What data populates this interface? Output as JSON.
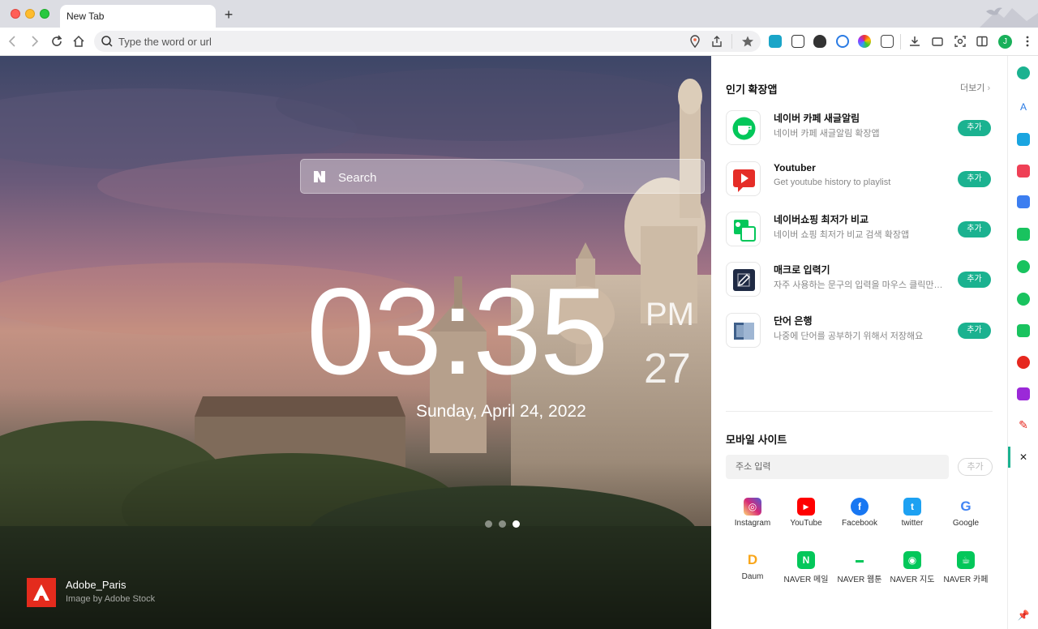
{
  "tab": {
    "title": "New Tab",
    "new_tab_symbol": "+"
  },
  "toolbar": {
    "url_placeholder": "Type the word or url",
    "profile_initial": "J",
    "icons": [
      "back-icon",
      "forward-icon",
      "reload-icon",
      "home-icon",
      "search-icon",
      "location-icon",
      "share-icon",
      "star-icon",
      "download-icon",
      "screen-capture-icon",
      "sidebar-toggle-icon",
      "more-menu-icon"
    ]
  },
  "newtab": {
    "search_placeholder": "Search",
    "clock": "03:35",
    "ampm": "PM",
    "seconds": "27",
    "date": "Sunday, April 24, 2022",
    "slides": 3,
    "active_slide": 3,
    "credit_title": "Adobe_Paris",
    "credit_subtitle": "Image by Adobe Stock"
  },
  "panel": {
    "popular_title": "인기 확장앱",
    "more_label": "더보기",
    "apps": [
      {
        "name": "네이버 카페 새글알림",
        "desc": "네이버 카페 새글알림 확장앱",
        "add": "추가",
        "icon": "cafe-icon",
        "color": "#03c75a"
      },
      {
        "name": "Youtuber",
        "desc": "Get youtube history to playlist",
        "add": "추가",
        "icon": "youtuber-icon",
        "color": "#e52d27"
      },
      {
        "name": "네이버쇼핑 최저가 비교",
        "desc": "네이버 쇼핑 최저가 비교 검색 확장앱",
        "add": "추가",
        "icon": "shopping-icon",
        "color": "#03c75a"
      },
      {
        "name": "매크로 입력기",
        "desc": "자주 사용하는 문구의 입력을 마우스 클릭만으로 입력할 수 있어요",
        "add": "추가",
        "icon": "macro-icon",
        "color": "#1f2a44"
      },
      {
        "name": "단어 은행",
        "desc": "나중에 단어를 공부하기 위해서 저장해요",
        "add": "추가",
        "icon": "word-bank-icon",
        "color": "#5b7fa8"
      }
    ],
    "mobile_title": "모바일 사이트",
    "address_placeholder": "주소 입력",
    "address_add": "추가",
    "sites": [
      {
        "label": "Instagram",
        "color": "#d6249f",
        "glyph": "◎"
      },
      {
        "label": "YouTube",
        "color": "#ff0000",
        "glyph": "▶"
      },
      {
        "label": "Facebook",
        "color": "#1877f2",
        "glyph": "f"
      },
      {
        "label": "twitter",
        "color": "#1da1f2",
        "glyph": "t"
      },
      {
        "label": "Google",
        "color": "#ffffff",
        "glyph": "G"
      },
      {
        "label": "Daum",
        "color": "#ffffff",
        "glyph": "D"
      },
      {
        "label": "NAVER 메일",
        "color": "#03c75a",
        "glyph": "N"
      },
      {
        "label": "NAVER 웹툰",
        "color": "#ffffff",
        "glyph": "W"
      },
      {
        "label": "NAVER 지도",
        "color": "#03c75a",
        "glyph": "◉"
      },
      {
        "label": "NAVER 카페",
        "color": "#03c75a",
        "glyph": "☕"
      }
    ]
  },
  "sidebar": {
    "icons": [
      {
        "name": "sidebar-naver-icon",
        "color": "#1bb290"
      },
      {
        "name": "sidebar-papago-icon",
        "color": "#2a7be4"
      },
      {
        "name": "sidebar-calendar-icon",
        "color": "#1aa5e0"
      },
      {
        "name": "sidebar-pocket-icon",
        "color": "#ef4056"
      },
      {
        "name": "sidebar-wallet-icon",
        "color": "#3c7ef0"
      },
      {
        "name": "sidebar-bell-icon",
        "color": "#19c35f"
      },
      {
        "name": "sidebar-cafe-icon",
        "color": "#19c35f"
      },
      {
        "name": "sidebar-chart-icon",
        "color": "#19c35f"
      },
      {
        "name": "sidebar-memo-icon",
        "color": "#19c35f"
      },
      {
        "name": "sidebar-music-icon",
        "color": "#e6281f"
      },
      {
        "name": "sidebar-audio-icon",
        "color": "#9b29d8"
      },
      {
        "name": "sidebar-pen-icon",
        "color": "#e6281f"
      },
      {
        "name": "sidebar-close-icon",
        "color": "#222222"
      },
      {
        "name": "sidebar-pin-icon",
        "color": "#333333"
      }
    ]
  }
}
